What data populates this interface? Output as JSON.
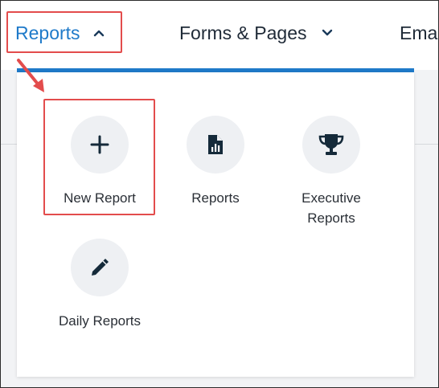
{
  "nav": {
    "reports_label": "Reports",
    "forms_label": "Forms & Pages",
    "email_label": "Emai"
  },
  "menu": {
    "items": [
      {
        "label": "New Report",
        "icon": "plus-icon"
      },
      {
        "label": "Reports",
        "icon": "report-document-icon"
      },
      {
        "label": "Executive Reports",
        "icon": "trophy-icon"
      },
      {
        "label": "Daily Reports",
        "icon": "pencil-icon"
      }
    ]
  },
  "colors": {
    "accent": "#1f7ac9",
    "highlight": "#e34c4c",
    "icon": "#152a3a",
    "circle": "#eef0f3"
  }
}
